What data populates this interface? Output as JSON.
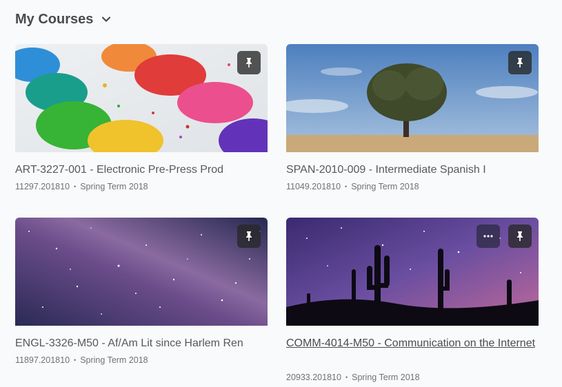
{
  "header": {
    "title": "My Courses",
    "chevron_icon": "chevron-down-icon"
  },
  "courses": [
    {
      "title": "ART-3227-001 - Electronic Pre-Press Prod",
      "code": "11297.201810",
      "term": "Spring Term 2018",
      "image": "watercolor-paint-palette",
      "pinned": true
    },
    {
      "title": "SPAN-2010-009 - Intermediate Spanish I",
      "code": "11049.201810",
      "term": "Spring Term 2018",
      "image": "lone-tree-field",
      "pinned": true
    },
    {
      "title": "ENGL-3326-M50 - Af/Am Lit since Harlem Ren",
      "code": "11897.201810",
      "term": "Spring Term 2018",
      "image": "purple-galaxy-stars",
      "pinned": true
    },
    {
      "title": "COMM-4014-M50 - Communication on the Internet",
      "code": "20933.201810",
      "term": "Spring Term 2018",
      "image": "cactus-milky-way",
      "pinned": true,
      "more_options": true
    }
  ],
  "icons": {
    "pin": "pin-icon",
    "more": "more-options-icon"
  },
  "meta_separator": "•"
}
